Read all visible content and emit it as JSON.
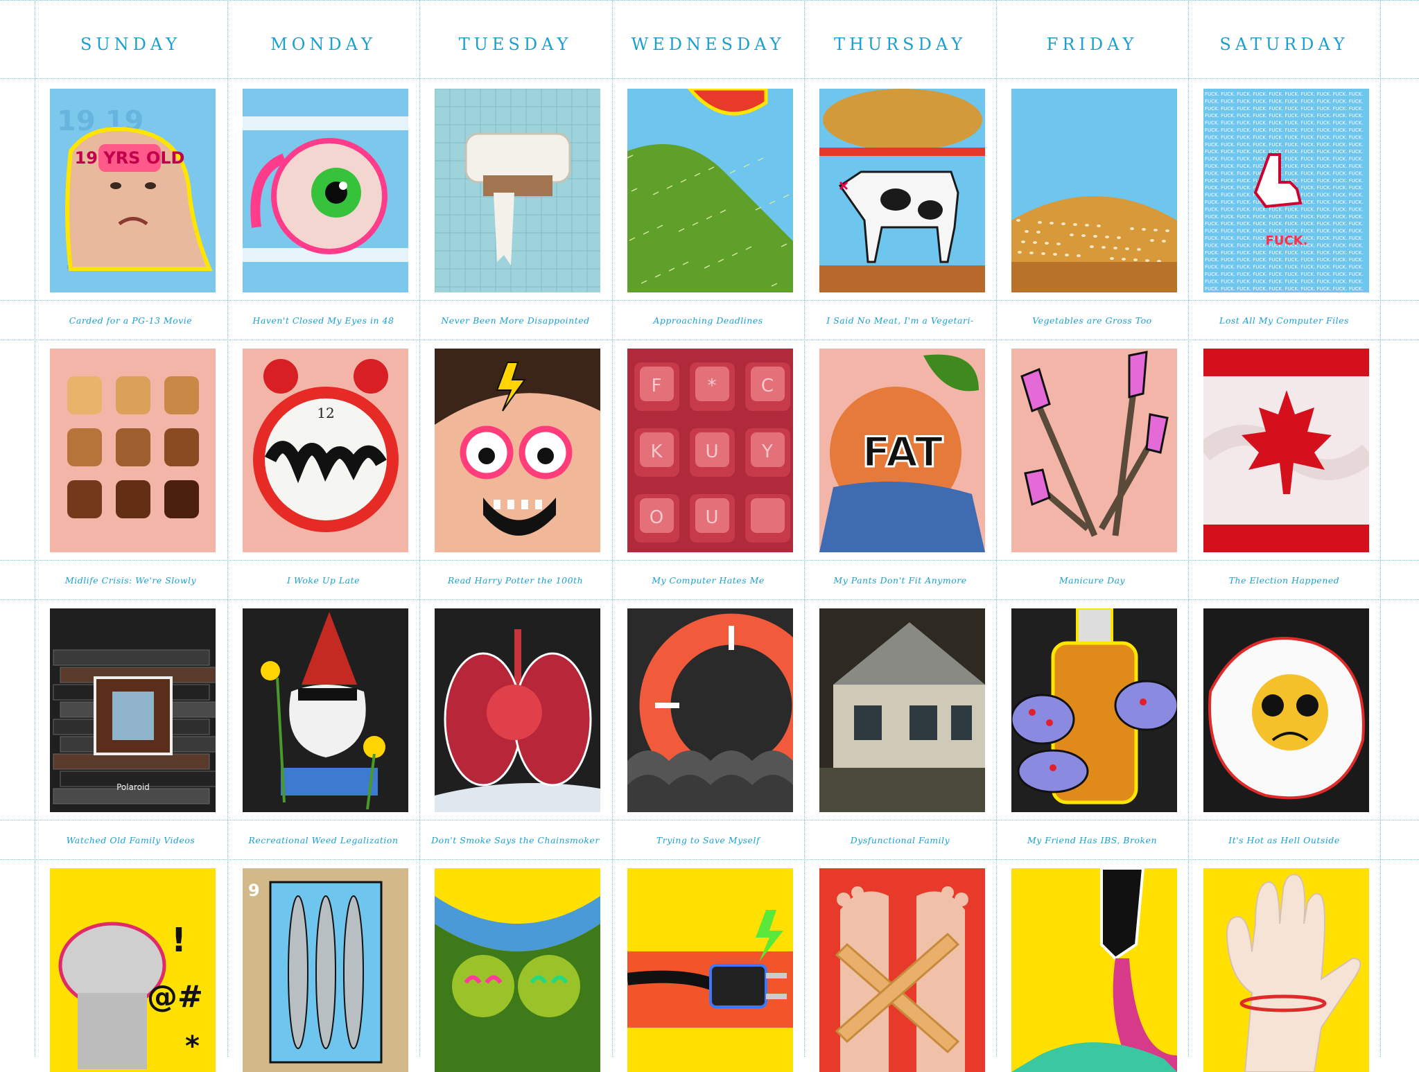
{
  "days": [
    "SUNDAY",
    "MONDAY",
    "TUESDAY",
    "WEDNESDAY",
    "THURSDAY",
    "FRIDAY",
    "SATURDAY"
  ],
  "weeks": [
    {
      "theme": "blue",
      "captions": [
        "Carded for a PG-13 Movie",
        "Haven't Closed My Eyes in 48",
        "Never Been More Disappointed",
        "Approaching Deadlines",
        "I Said No Meat, I'm a Vegetari-",
        "Vegetables are Gross Too",
        "Lost All My Computer Files"
      ],
      "tiles": [
        {
          "icon": "baby-face-icon",
          "text": "19 YRS OLD"
        },
        {
          "icon": "eyeball-icon",
          "text": ""
        },
        {
          "icon": "toilet-paper-holder-icon",
          "text": ""
        },
        {
          "icon": "cactus-balloon-icon",
          "text": ""
        },
        {
          "icon": "cow-burger-icon",
          "text": ""
        },
        {
          "icon": "burger-bun-icon",
          "text": ""
        },
        {
          "icon": "middle-finger-cursor-icon",
          "text": "FUCK."
        }
      ]
    },
    {
      "theme": "pink",
      "captions": [
        "Midlife Crisis: We're Slowly",
        "I Woke Up Late",
        "Read Harry Potter the 100th",
        "My Computer Hates Me",
        "My Pants Don't Fit Anymore",
        "Manicure Day",
        "The Election Happened"
      ],
      "tiles": [
        {
          "icon": "toast-grid-icon",
          "text": ""
        },
        {
          "icon": "alarm-clock-icon",
          "text": ""
        },
        {
          "icon": "boy-glasses-icon",
          "text": ""
        },
        {
          "icon": "keyboard-keys-icon",
          "text": "F * C K U Y O U"
        },
        {
          "icon": "peach-jeans-icon",
          "text": "FAT"
        },
        {
          "icon": "nail-polish-icon",
          "text": ""
        },
        {
          "icon": "maple-leaf-flag-icon",
          "text": ""
        }
      ]
    },
    {
      "theme": "dark",
      "captions": [
        "Watched Old Family Videos",
        "Recreational Weed Legalization",
        "Don't Smoke Says the Chainsmoker",
        "Trying to Save Myself",
        "Dysfunctional Family",
        "My Friend Has IBS, Broken",
        "It's Hot as Hell Outside"
      ],
      "tiles": [
        {
          "icon": "vhs-tapes-house-icon",
          "text": "Polaroid"
        },
        {
          "icon": "garden-gnome-icon",
          "text": ""
        },
        {
          "icon": "lungs-icon",
          "text": ""
        },
        {
          "icon": "life-ring-icon",
          "text": ""
        },
        {
          "icon": "glitch-house-icon",
          "text": ""
        },
        {
          "icon": "bottle-mushrooms-icon",
          "text": ""
        },
        {
          "icon": "fried-egg-icon",
          "text": ""
        }
      ]
    },
    {
      "theme": "yellow",
      "captions": [
        "",
        "",
        "",
        "",
        "",
        "",
        ""
      ],
      "tiles": [
        {
          "icon": "toilet-swearing-icon",
          "text": "!@#$*"
        },
        {
          "icon": "subway-sardines-icon",
          "text": "9"
        },
        {
          "icon": "peas-pod-icon",
          "text": ""
        },
        {
          "icon": "power-plug-icon",
          "text": ""
        },
        {
          "icon": "bandaged-feet-icon",
          "text": ""
        },
        {
          "icon": "paint-tube-icon",
          "text": ""
        },
        {
          "icon": "hand-rubber-band-icon",
          "text": ""
        }
      ]
    }
  ],
  "colors": {
    "accent": "#1a9fd0",
    "grid": "#7fc4de",
    "blue_bg": "#7cc8ec",
    "pink_bg": "#f3b5a8",
    "dark_bg": "#1f1f1f",
    "yellow_bg": "#ffe000"
  }
}
